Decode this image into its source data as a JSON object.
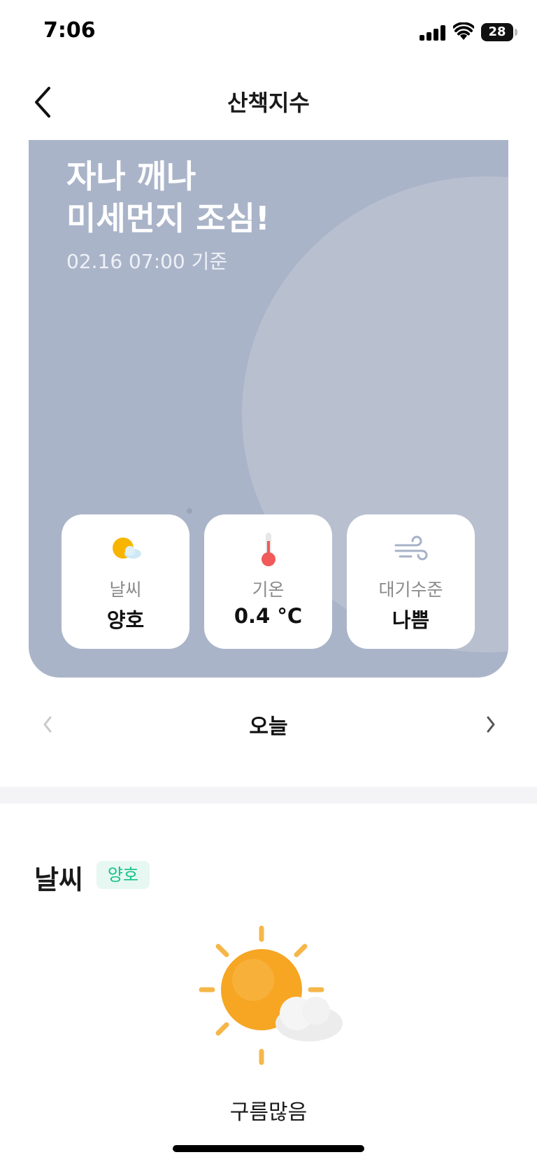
{
  "status_bar": {
    "time": "7:06",
    "battery": "28"
  },
  "nav": {
    "title": "산책지수",
    "back_icon": "chevron-left-icon"
  },
  "hero": {
    "headline_line1": "자나 깨나",
    "headline_line2": "미세먼지 조심!",
    "date": "02.16 07:00 기준",
    "background_color": "#aab4c9",
    "tiles": [
      {
        "icon": "sun-cloud-icon",
        "label": "날씨",
        "value": "양호"
      },
      {
        "icon": "thermometer-icon",
        "label": "기온",
        "value": "0.4 °C"
      },
      {
        "icon": "wind-icon",
        "label": "대기수준",
        "value": "나쁨"
      }
    ]
  },
  "day_nav": {
    "label": "오늘",
    "prev_icon": "chevron-left-icon",
    "next_icon": "chevron-right-icon"
  },
  "weather_section": {
    "title": "날씨",
    "badge": "양호",
    "badge_color": "#17c18a",
    "icon": "sun-behind-cloud-icon",
    "description": "구름많음"
  }
}
